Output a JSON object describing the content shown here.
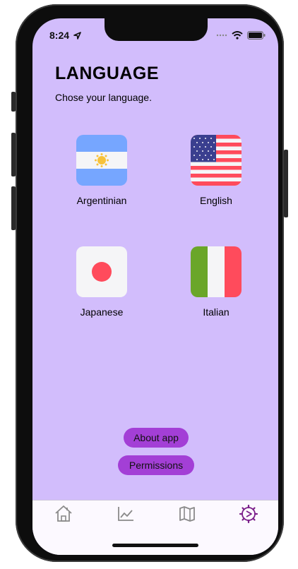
{
  "status_bar": {
    "time": "8:24"
  },
  "page": {
    "title": "LANGUAGE",
    "subtitle": "Chose your language."
  },
  "languages": [
    {
      "label": "Argentinian",
      "flag": "argentina-flag-icon"
    },
    {
      "label": "English",
      "flag": "usa-flag-icon"
    },
    {
      "label": "Japanese",
      "flag": "japan-flag-icon"
    },
    {
      "label": "Italian",
      "flag": "italy-flag-icon"
    }
  ],
  "buttons": {
    "about": "About app",
    "permissions": "Permissions"
  },
  "tabs": [
    {
      "icon": "home-icon",
      "active": false
    },
    {
      "icon": "chart-icon",
      "active": false
    },
    {
      "icon": "map-icon",
      "active": false
    },
    {
      "icon": "settings-icon",
      "active": true
    }
  ],
  "colors": {
    "background": "#d2bdfc",
    "accent": "#a33fd6",
    "active_tab": "#7b1f8a",
    "inactive_tab": "#8a8a8a"
  }
}
